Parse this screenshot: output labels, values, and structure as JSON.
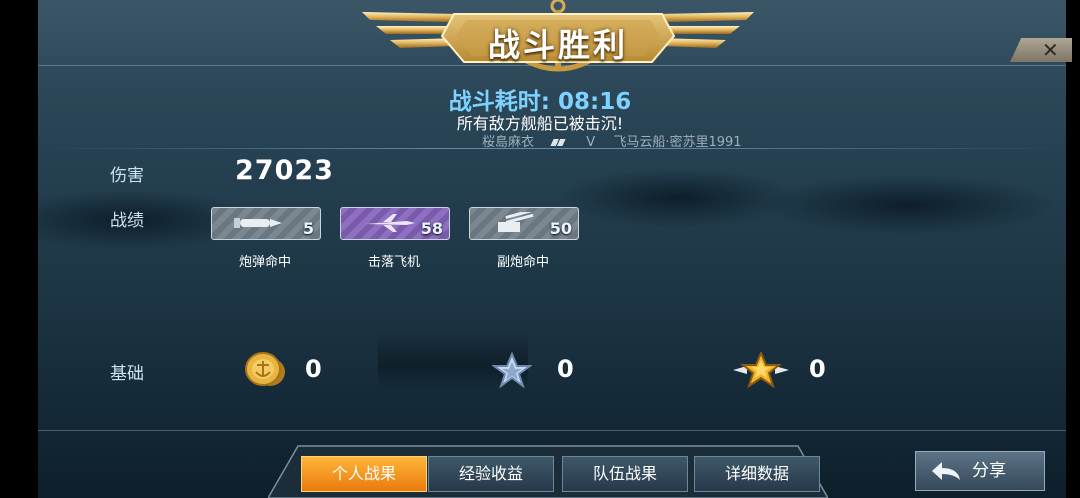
{
  "header": {
    "title": "战斗胜利",
    "close_symbol": "✕"
  },
  "summary": {
    "battle_time": "战斗耗时: 08:16",
    "result_text": "所有敌方舰船已被击沉!",
    "player_left": "桜島麻衣",
    "vs": "V",
    "player_right": "飞马云船·密苏里1991"
  },
  "damage": {
    "label": "伤害",
    "value": "27023"
  },
  "record": {
    "label": "战绩",
    "badges": [
      {
        "name": "炮弹命中",
        "value": "5",
        "color": "gray",
        "icon": "shell-icon"
      },
      {
        "name": "击落飞机",
        "value": "58",
        "color": "purple",
        "icon": "plane-icon"
      },
      {
        "name": "副炮命中",
        "value": "50",
        "color": "gray",
        "icon": "secondary-gun-icon"
      }
    ]
  },
  "base": {
    "label": "基础",
    "items": [
      {
        "icon": "gold-coin-icon",
        "value": "0"
      },
      {
        "icon": "silver-star-icon",
        "value": "0"
      },
      {
        "icon": "gold-star-icon",
        "value": "0"
      }
    ]
  },
  "tabs": [
    "个人战果",
    "经验收益",
    "队伍战果",
    "详细数据"
  ],
  "active_tab": "个人战果",
  "share": {
    "label": "分享"
  },
  "colors": {
    "time": "#7ed2ff",
    "active_tab": "#f3931f",
    "gold": "#d9a437"
  }
}
